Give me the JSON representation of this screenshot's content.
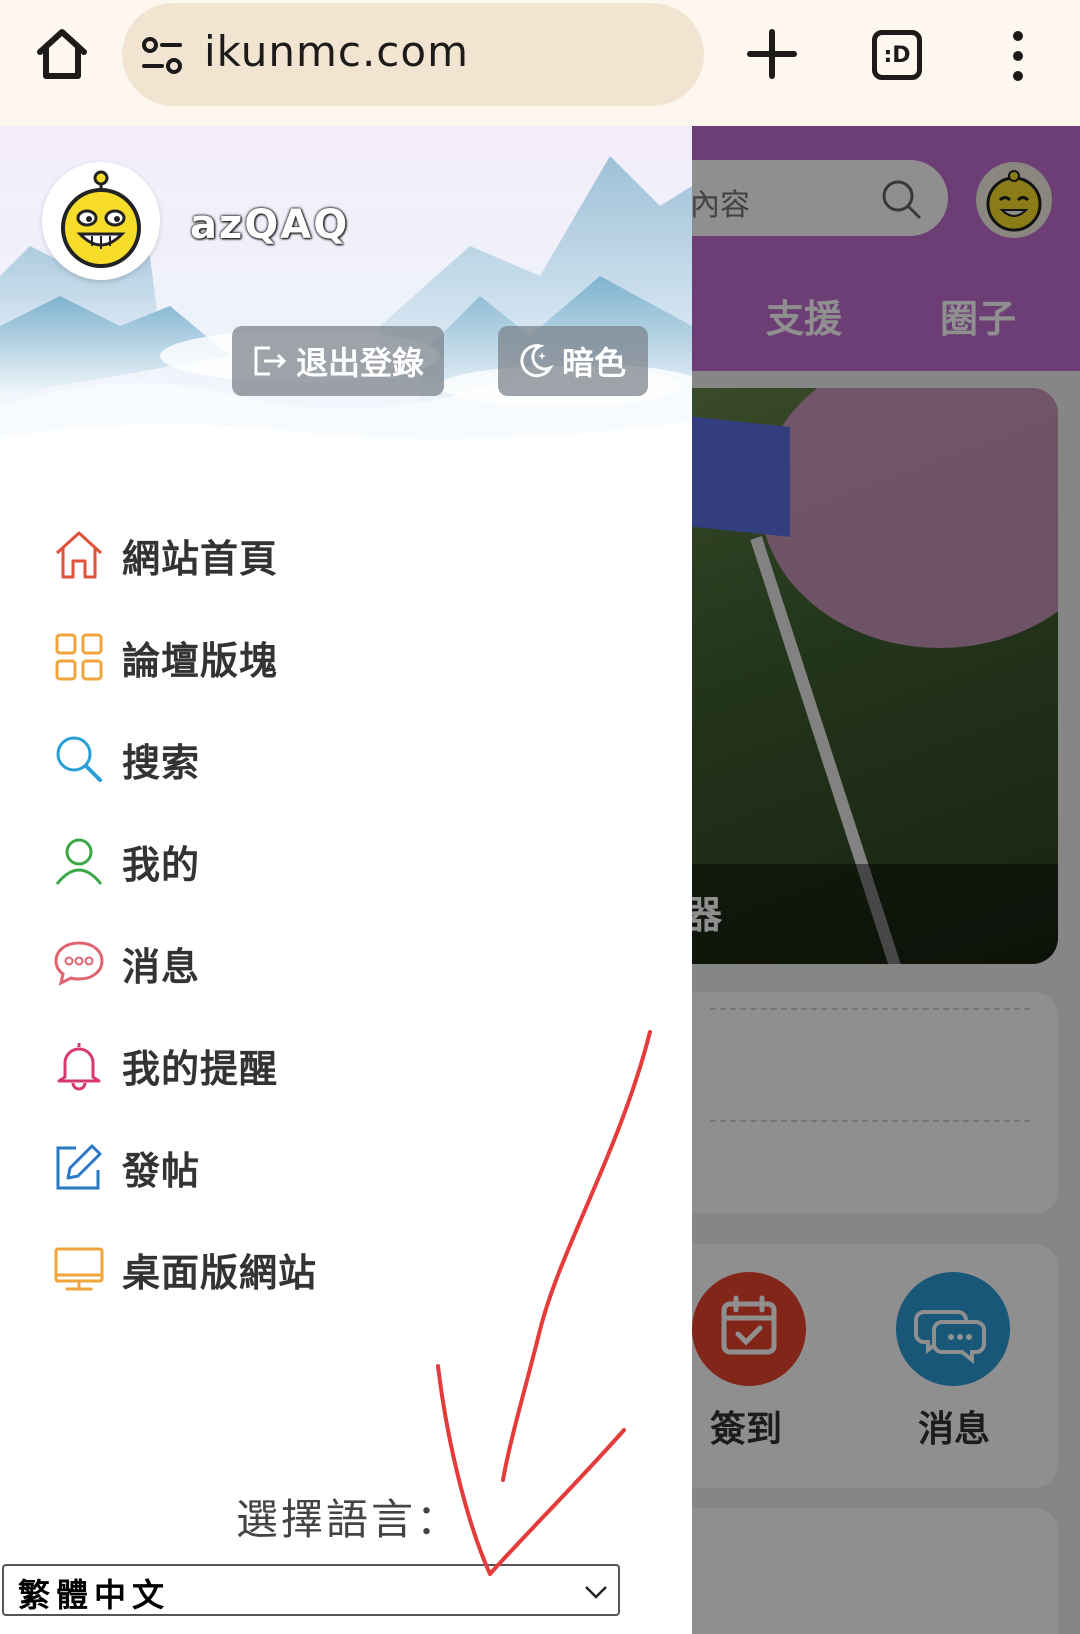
{
  "browser": {
    "url": "ikunmc.com",
    "tabs_icon_text": ":D"
  },
  "background_page": {
    "search_placeholder": "內容",
    "nav": [
      "支援",
      "圈子"
    ],
    "banner_caption": "器",
    "quick_actions": [
      {
        "label": "簽到",
        "icon": "calendar-check-icon",
        "color": "#e8452f"
      },
      {
        "label": "消息",
        "icon": "chat-bubbles-icon",
        "color": "#2b9bd6"
      }
    ]
  },
  "drawer": {
    "username": "azQAQ",
    "logout_label": "退出登錄",
    "dark_label": "暗色",
    "menu": [
      {
        "label": "網站首頁",
        "icon": "home-icon",
        "color": "#e0523a"
      },
      {
        "label": "論壇版塊",
        "icon": "grid-icon",
        "color": "#f0a43a"
      },
      {
        "label": "搜索",
        "icon": "search-icon",
        "color": "#2a9fd6"
      },
      {
        "label": "我的",
        "icon": "user-icon",
        "color": "#3aa845"
      },
      {
        "label": "消息",
        "icon": "chat-icon",
        "color": "#e06470"
      },
      {
        "label": "我的提醒",
        "icon": "bell-icon",
        "color": "#d63a6a"
      },
      {
        "label": "發帖",
        "icon": "edit-icon",
        "color": "#2a79c6"
      },
      {
        "label": "桌面版網站",
        "icon": "monitor-icon",
        "color": "#f0a43a"
      }
    ],
    "language_label": "選擇語言：",
    "language_selected": "繁體中文"
  }
}
